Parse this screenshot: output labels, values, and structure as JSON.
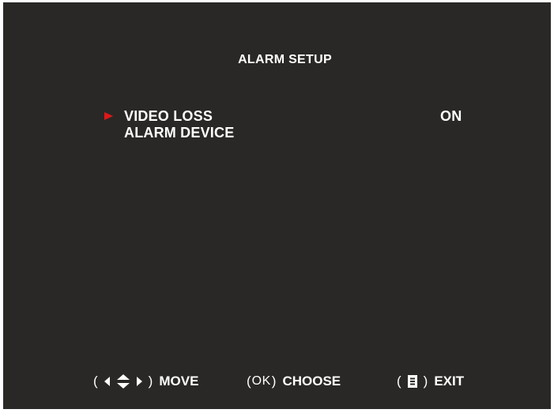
{
  "screen": {
    "title": "ALARM SETUP"
  },
  "menu": {
    "items": [
      {
        "label": "VIDEO LOSS",
        "value": "ON",
        "selected": true
      },
      {
        "label": "ALARM DEVICE",
        "value": "",
        "selected": false
      }
    ]
  },
  "footer": {
    "move": {
      "open": "(",
      "close": ")",
      "icon": "arrows-icon",
      "label": "MOVE"
    },
    "choose": {
      "open": "(",
      "key": "OK",
      "close": ")",
      "label": "CHOOSE"
    },
    "exit": {
      "open": "(",
      "close": ")",
      "icon": "menu-icon",
      "label": "EXIT"
    }
  },
  "colors": {
    "background": "#2a2826",
    "text": "#ffffff",
    "pointer": "#e01818"
  }
}
